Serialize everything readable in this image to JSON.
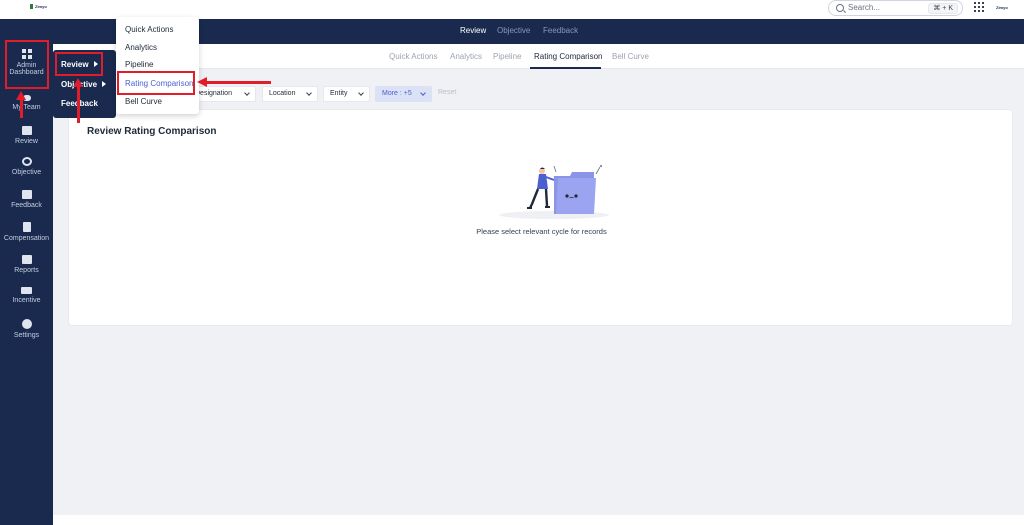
{
  "topbar": {
    "logo_text": "Zimyo",
    "search_placeholder": "Search...",
    "search_shortcut": "⌘ + K",
    "apps_icon": "grid-icon"
  },
  "nav": {
    "tabs": [
      {
        "label": "Review",
        "active": true
      },
      {
        "label": "Objective",
        "active": false
      },
      {
        "label": "Feedback",
        "active": false
      }
    ]
  },
  "sidebar": {
    "items": [
      {
        "label": "Admin Dashboard",
        "icon": "dashboard-icon"
      },
      {
        "label": "My Team",
        "icon": "team-icon"
      },
      {
        "label": "Review",
        "icon": "review-icon"
      },
      {
        "label": "Objective",
        "icon": "target-icon"
      },
      {
        "label": "Feedback",
        "icon": "feedback-icon"
      },
      {
        "label": "Compensation",
        "icon": "document-icon"
      },
      {
        "label": "Reports",
        "icon": "chart-icon"
      },
      {
        "label": "Incentive",
        "icon": "wallet-icon"
      },
      {
        "label": "Settings",
        "icon": "gear-icon"
      }
    ]
  },
  "subtabs": [
    {
      "label": "Quick Actions",
      "active": false
    },
    {
      "label": "Analytics",
      "active": false
    },
    {
      "label": "Pipeline",
      "active": false
    },
    {
      "label": "Rating Comparison",
      "active": true
    },
    {
      "label": "Bell Curve",
      "active": false
    }
  ],
  "filters": {
    "designation": "Designation",
    "location": "Location",
    "entity": "Entity",
    "more": "More : +5",
    "reset": "Reset"
  },
  "card": {
    "title": "Review Rating Comparison",
    "empty_message": "Please select relevant cycle for records"
  },
  "menu1": {
    "items": [
      {
        "label": "Review"
      },
      {
        "label": "Objective"
      },
      {
        "label": "Feedback"
      }
    ]
  },
  "menu2": {
    "items": [
      {
        "label": "Quick Actions"
      },
      {
        "label": "Analytics"
      },
      {
        "label": "Pipeline"
      },
      {
        "label": "Rating Comparison",
        "active": true
      },
      {
        "label": "Bell Curve"
      }
    ]
  },
  "colors": {
    "navy": "#192a4e",
    "accent": "#4a5fd0",
    "annotation": "#e11d2a"
  }
}
